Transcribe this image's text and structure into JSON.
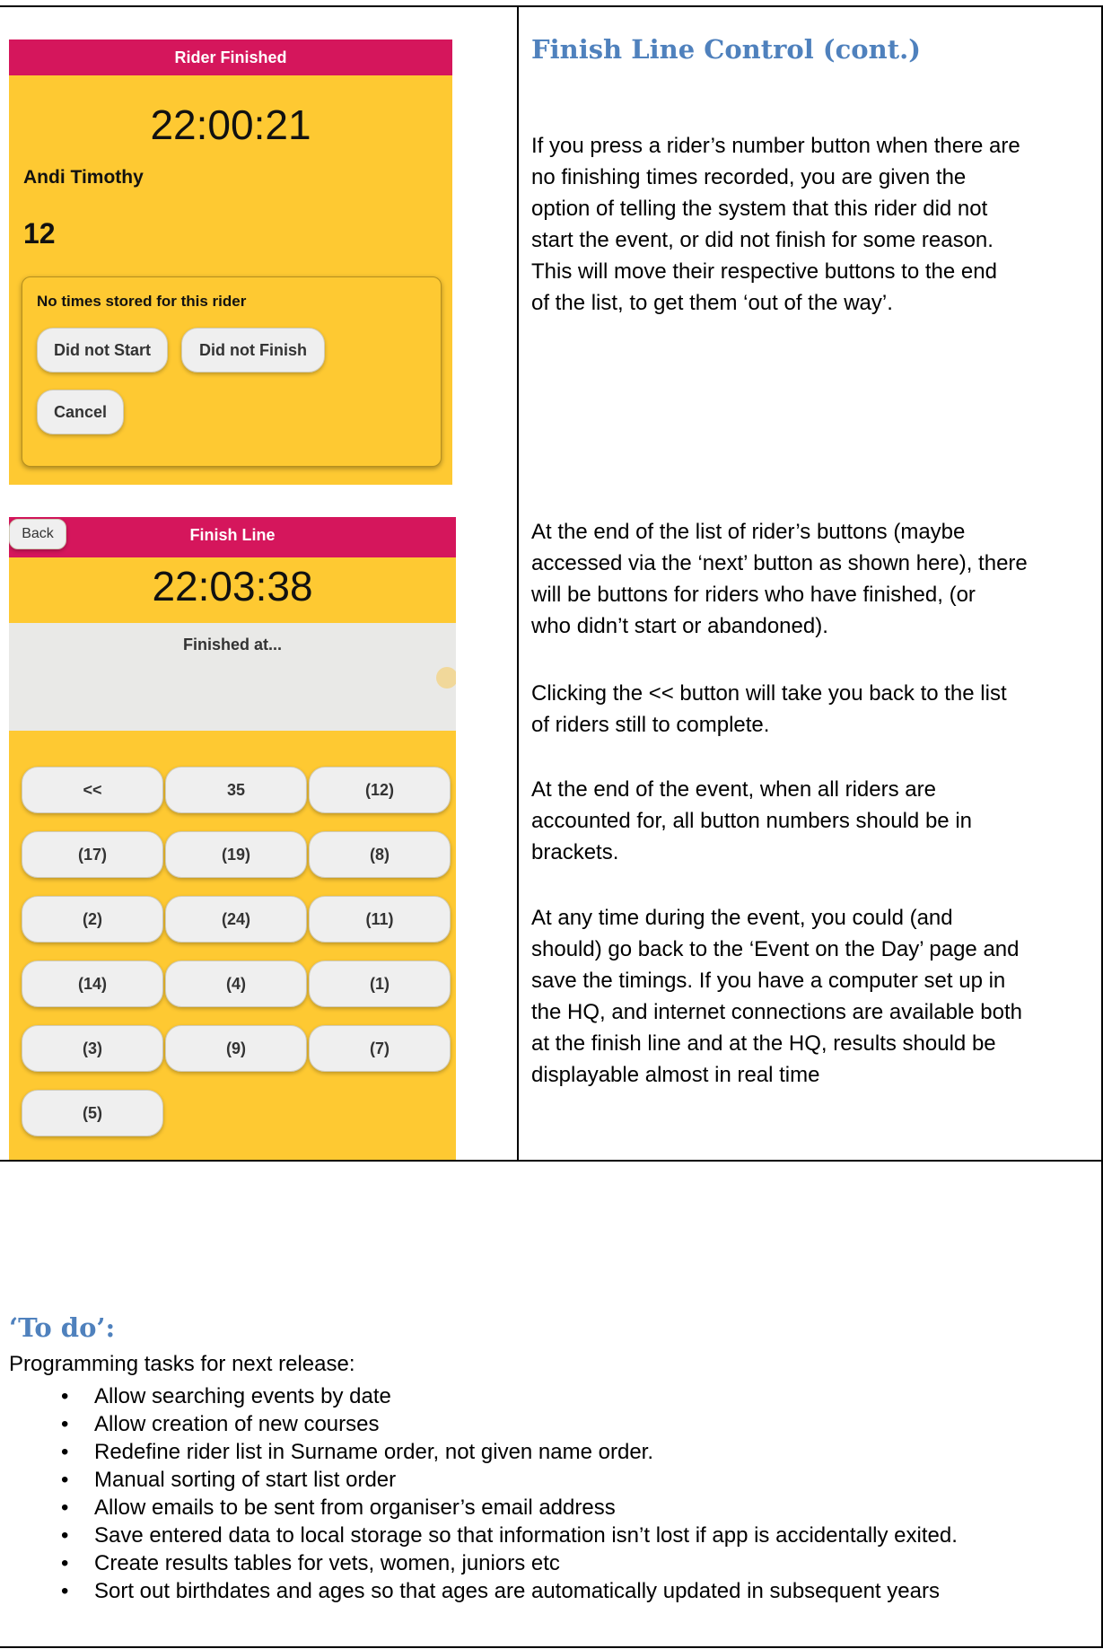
{
  "rider_finished_screen": {
    "header_title": "Rider Finished",
    "clock": "22:00:21",
    "rider_name": "Andi Timothy",
    "rider_number": "12",
    "dialog": {
      "message": "No times stored for this rider",
      "did_not_start_label": "Did not Start",
      "did_not_finish_label": "Did not Finish",
      "cancel_label": "Cancel"
    }
  },
  "finish_line_screen": {
    "back_label": "Back",
    "header_title": "Finish Line",
    "clock": "22:03:38",
    "finished_at_label": "Finished at...",
    "buttons": [
      "<<",
      "35",
      "(12)",
      "(17)",
      "(19)",
      "(8)",
      "(2)",
      "(24)",
      "(11)",
      "(14)",
      "(4)",
      "(1)",
      "(3)",
      "(9)",
      "(7)",
      "(5)"
    ]
  },
  "section_heading": "Finish Line Control (cont.)",
  "paragraph_1": [
    "If you press a rider’s number button when there are",
    "no finishing times recorded, you are given the",
    "option of telling the system that this rider did not",
    "start the event, or did not finish for some reason.",
    "This will move their respective buttons to the end",
    "of the list, to get them ‘out of the way’."
  ],
  "paragraph_2": [
    "At the end of the list of rider’s buttons (maybe",
    "accessed via the ‘next’ button as shown here), there",
    "will be buttons for riders who have finished, (or",
    "who didn’t start or abandoned)."
  ],
  "paragraph_3": [
    "Clicking the << button will take you back to the list",
    "of riders still to complete."
  ],
  "paragraph_4": [
    "At the end of the event, when all riders are",
    "accounted for, all button numbers should be in",
    "brackets."
  ],
  "paragraph_5": [
    "At any time during the event, you could (and",
    "should) go back to the ‘Event on the Day’ page and",
    "save the timings. If you have a computer set up in",
    "the HQ, and internet connections are available both",
    "at the finish line and at the HQ, results should be",
    "displayable almost in real time"
  ],
  "todo": {
    "heading": "‘To do’:",
    "intro": "Programming tasks for next release:",
    "items": [
      "Allow searching events by date",
      "Allow creation of new courses",
      "Redefine rider list in Surname order, not given name order.",
      "Manual sorting of start list order",
      "Allow emails to be sent from organiser’s email address",
      "Save entered data to local storage so that information isn’t lost if app is accidentally exited.",
      "Create results tables for vets, women, juniors etc",
      "Sort out birthdates and ages so that ages are automatically updated in subsequent years"
    ]
  }
}
